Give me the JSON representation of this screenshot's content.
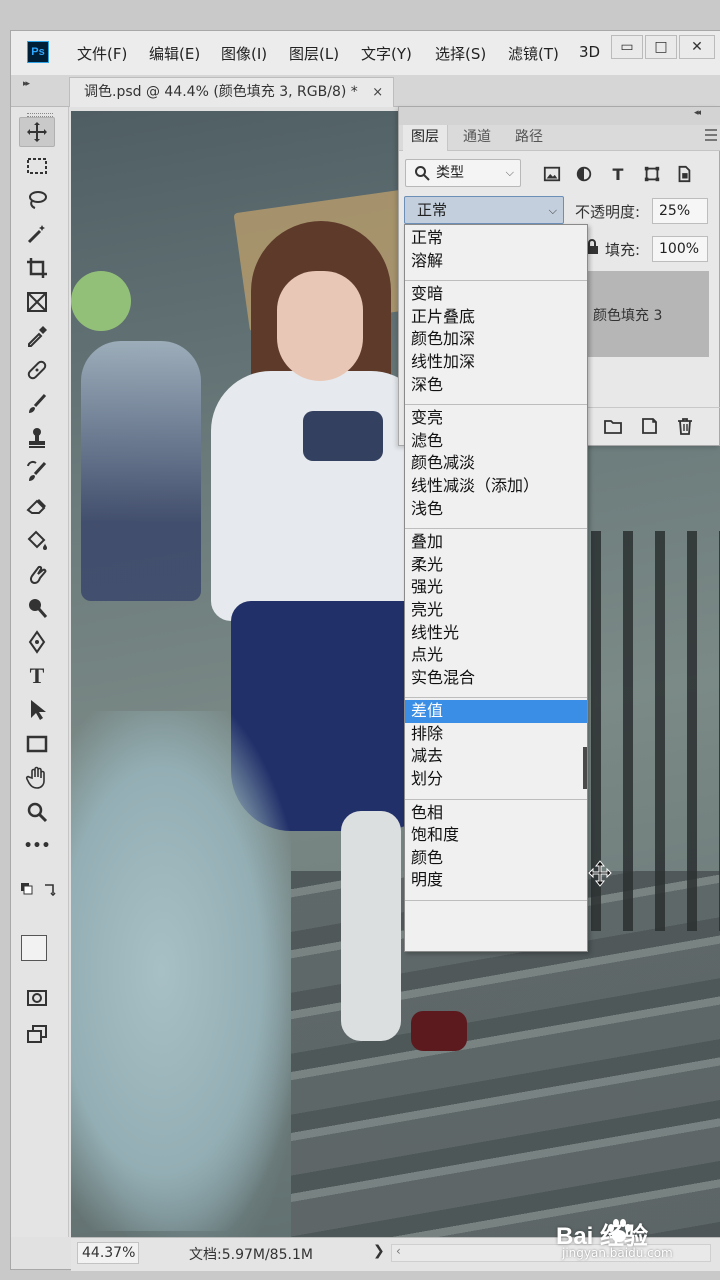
{
  "app": {
    "logo": "Ps",
    "menus": [
      "文件(F)",
      "编辑(E)",
      "图像(I)",
      "图层(L)",
      "文字(Y)",
      "选择(S)",
      "滤镜(T)",
      "3D"
    ],
    "window_controls": {
      "minimize": "▭",
      "restore": "□",
      "close": "✕"
    }
  },
  "document_tab": {
    "label": "调色.psd @ 44.4% (颜色填充 3, RGB/8) *",
    "close": "×"
  },
  "toolbar": {
    "tools": [
      "move-tool",
      "marquee-tool",
      "lasso-tool",
      "magic-wand-tool",
      "crop-tool",
      "frame-tool",
      "eyedropper-tool",
      "healing-brush-tool",
      "brush-tool",
      "clone-stamp-tool",
      "history-brush-tool",
      "eraser-tool",
      "paint-bucket-tool",
      "smudge-tool",
      "dodge-tool",
      "pen-tool",
      "type-tool",
      "path-selection-tool",
      "rectangle-tool",
      "hand-tool",
      "zoom-tool",
      "more-tools",
      "quick-mask",
      "screen-mode"
    ],
    "type_tool_glyph": "T",
    "more_tools_glyph": "•••"
  },
  "layers_panel": {
    "tabs": [
      "图层",
      "通道",
      "路径"
    ],
    "filter": {
      "value": "类型"
    },
    "blend_mode": {
      "value": "正常"
    },
    "opacity": {
      "label": "不透明度:",
      "value": "25%"
    },
    "fill": {
      "label": "填充:",
      "value": "100%"
    },
    "layer": {
      "name": "颜色填充 3"
    },
    "filter_icons": {
      "type": "T"
    }
  },
  "blend_mode_dropdown": {
    "groups": [
      [
        "正常",
        "溶解"
      ],
      [
        "变暗",
        "正片叠底",
        "颜色加深",
        "线性加深",
        "深色"
      ],
      [
        "变亮",
        "滤色",
        "颜色减淡",
        "线性减淡（添加）",
        "浅色"
      ],
      [
        "叠加",
        "柔光",
        "强光",
        "亮光",
        "线性光",
        "点光",
        "实色混合"
      ],
      [
        "差值",
        "排除",
        "减去",
        "划分"
      ],
      [
        "色相",
        "饱和度",
        "颜色",
        "明度"
      ]
    ],
    "highlighted": "差值"
  },
  "status_bar": {
    "zoom": "44.37%",
    "doc_size": "文档:5.97M/85.1M",
    "arrow": "❯"
  },
  "watermark": {
    "brand": "Bai  经验",
    "url": "jingyan.baidu.com"
  },
  "colors": {
    "accent": "#3b8ee6",
    "selected_text": "#ffffff"
  }
}
